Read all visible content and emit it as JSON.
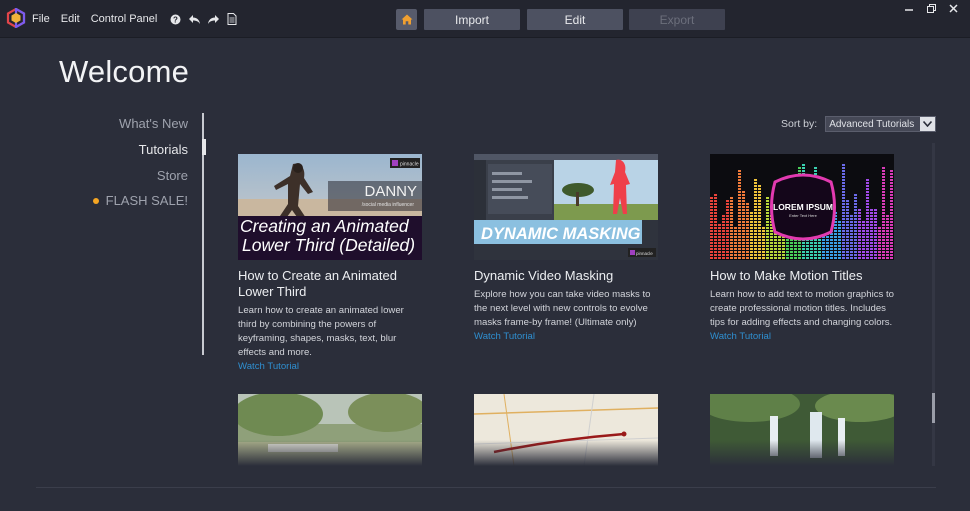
{
  "menu": {
    "file": "File",
    "edit": "Edit",
    "control_panel": "Control Panel"
  },
  "toolbar": {
    "import": "Import",
    "edit": "Edit",
    "export": "Export"
  },
  "page": {
    "title": "Welcome"
  },
  "nav": {
    "items": [
      "What's New",
      "Tutorials",
      "Store",
      "FLASH SALE!"
    ],
    "active": "Tutorials"
  },
  "sort": {
    "label": "Sort by:",
    "value": "Advanced Tutorials"
  },
  "cards": [
    {
      "title": "How to Create an Animated Lower Third",
      "description": "Learn how to create an animated lower third by combining the powers of keyframing, shapes, masks, text, blur effects and more.",
      "link": "Watch Tutorial",
      "thumb": {
        "name": "DANNY",
        "subtitle": "/social media influencer",
        "line1": "Creating an Animated",
        "line2": "Lower Third (Detailed)",
        "badge": "pinnacle"
      }
    },
    {
      "title": "Dynamic Video Masking",
      "description": "Explore how you can take video masks to the next level with new controls to evolve masks frame-by frame! (Ultimate only)",
      "link": "Watch Tutorial",
      "thumb": {
        "banner": "DYNAMIC MASKING",
        "badge": "pinnacle"
      }
    },
    {
      "title": "How to Make Motion Titles",
      "description": "Learn how to add text to motion graphics to create professional motion titles. Includes tips for adding effects and changing colors.",
      "link": "Watch Tutorial",
      "thumb": {
        "headline": "LOREM IPSUM",
        "sub": "Enter Text Here"
      }
    }
  ],
  "colors": {
    "background": "#2b2e3a",
    "titlebar": "#23252f",
    "link": "#2f8fd0",
    "sale_dot": "#f5a623"
  }
}
